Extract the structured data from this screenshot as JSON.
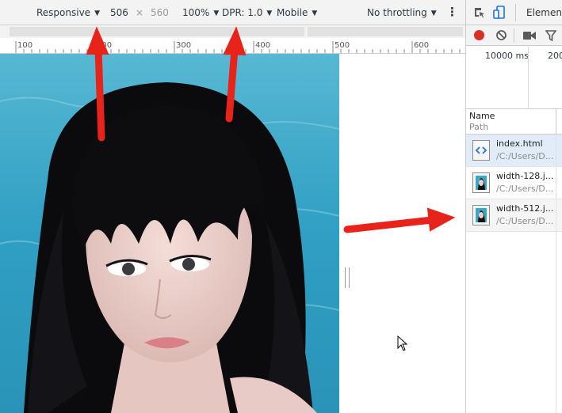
{
  "device_toolbar": {
    "device": "Responsive",
    "width": "506",
    "times": "×",
    "height": "560",
    "zoom": "100%",
    "dpr": "DPR: 1.0",
    "device_type": "Mobile",
    "throttling": "No throttling"
  },
  "ruler": {
    "labels": [
      "100",
      "200",
      "300",
      "400",
      "500",
      "600"
    ]
  },
  "devtools": {
    "elements_tab": "Elements",
    "overview_time_1": "10000 ms",
    "overview_time_2": "200",
    "columns": {
      "name": "Name",
      "path": "Path"
    },
    "requests": [
      {
        "name": "index.html",
        "path": "/C:/Users/D..."
      },
      {
        "name": "width-128.j...",
        "path": "/C:/Users/D..."
      },
      {
        "name": "width-512.j...",
        "path": "/C:/Users/D..."
      }
    ]
  },
  "colors": {
    "annotation_arrow": "#e8231a",
    "record_red": "#d93025",
    "selected_row": "#e1ecf8",
    "toolbar_bg": "#f3f3f3"
  },
  "icons": {
    "inspect": "inspect-element-icon",
    "device": "device-toolbar-icon",
    "record": "record-icon",
    "clear": "clear-icon",
    "screenshot": "video-camera-icon",
    "filter": "filter-icon",
    "more": "more-options-icon",
    "html_file": "html-file-icon",
    "image_file": "image-file-icon",
    "cursor": "mouse-cursor-icon"
  }
}
